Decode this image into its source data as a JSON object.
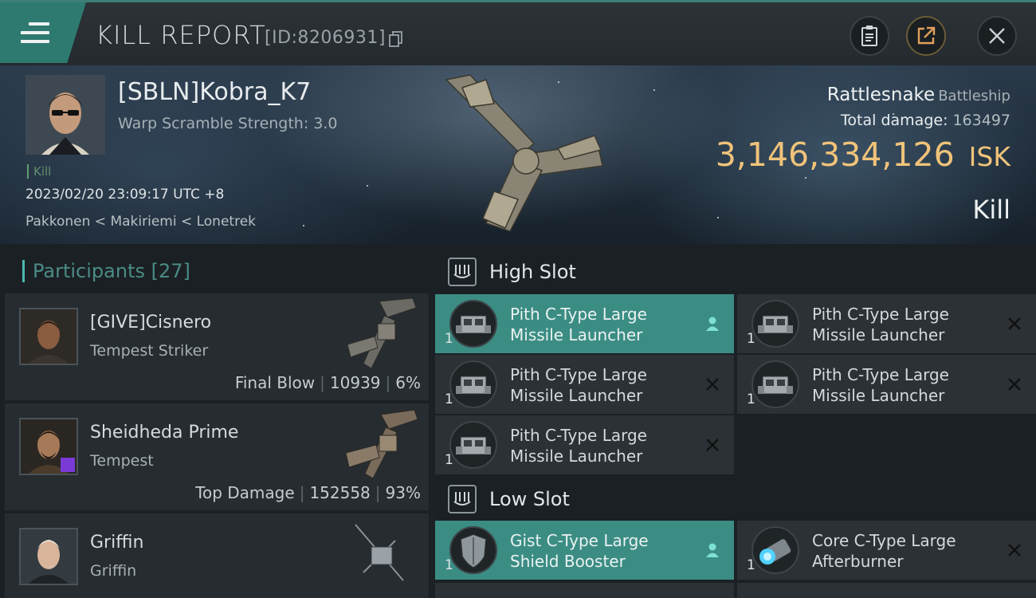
{
  "header": {
    "title": "KILL REPORT",
    "report_id": "[ID:8206931]",
    "icons": [
      "menu-icon",
      "copy-icon",
      "clipboard-icon",
      "share-icon",
      "close-icon"
    ]
  },
  "victim": {
    "name": "[SBLN]Kobra_K7",
    "warp_scramble": "Warp Scramble Strength: 3.0",
    "kill_tag": "Kill",
    "timestamp": "2023/02/20 23:09:17 UTC +8",
    "location": "Pakkonen < Makiriemi < Lonetrek",
    "ship_name": "Rattlesnake",
    "ship_class": "Battleship",
    "total_damage_label": "Total damage:",
    "total_damage": "163497",
    "isk_value": "3,146,334,126",
    "isk_unit": "ISK",
    "result": "Kill"
  },
  "participants": {
    "label": "Participants",
    "count": "[27]",
    "rows": [
      {
        "name": "[GIVE]Cisnero",
        "ship": "Tempest Striker",
        "role": "Final Blow",
        "damage": "10939",
        "percent": "6%"
      },
      {
        "name": "Sheidheda Prime",
        "ship": "Tempest",
        "role": "Top Damage",
        "damage": "152558",
        "percent": "93%"
      },
      {
        "name": "Griffin",
        "ship": "Griffin"
      }
    ]
  },
  "slots": {
    "high": {
      "title": "High Slot",
      "modules": [
        {
          "name_line1": "Pith C-Type Large",
          "name_line2": "Missile Launcher",
          "qty": "1",
          "status": "dropped"
        },
        {
          "name_line1": "Pith C-Type Large",
          "name_line2": "Missile Launcher",
          "qty": "1",
          "status": "destroyed"
        },
        {
          "name_line1": "Pith C-Type Large",
          "name_line2": "Missile Launcher",
          "qty": "1",
          "status": "destroyed"
        },
        {
          "name_line1": "Pith C-Type Large",
          "name_line2": "Missile Launcher",
          "qty": "1",
          "status": "destroyed"
        },
        {
          "name_line1": "Pith C-Type Large",
          "name_line2": "Missile Launcher",
          "qty": "1",
          "status": "destroyed"
        }
      ]
    },
    "low": {
      "title": "Low Slot",
      "modules": [
        {
          "name_line1": "Gist C-Type Large",
          "name_line2": "Shield Booster",
          "qty": "1",
          "status": "dropped"
        },
        {
          "name_line1": "Core C-Type Large",
          "name_line2": "Afterburner",
          "qty": "1",
          "status": "destroyed"
        }
      ]
    }
  },
  "colors": {
    "accent": "#3b8d84",
    "isk": "#f0c37a",
    "background": "#1b2024"
  }
}
